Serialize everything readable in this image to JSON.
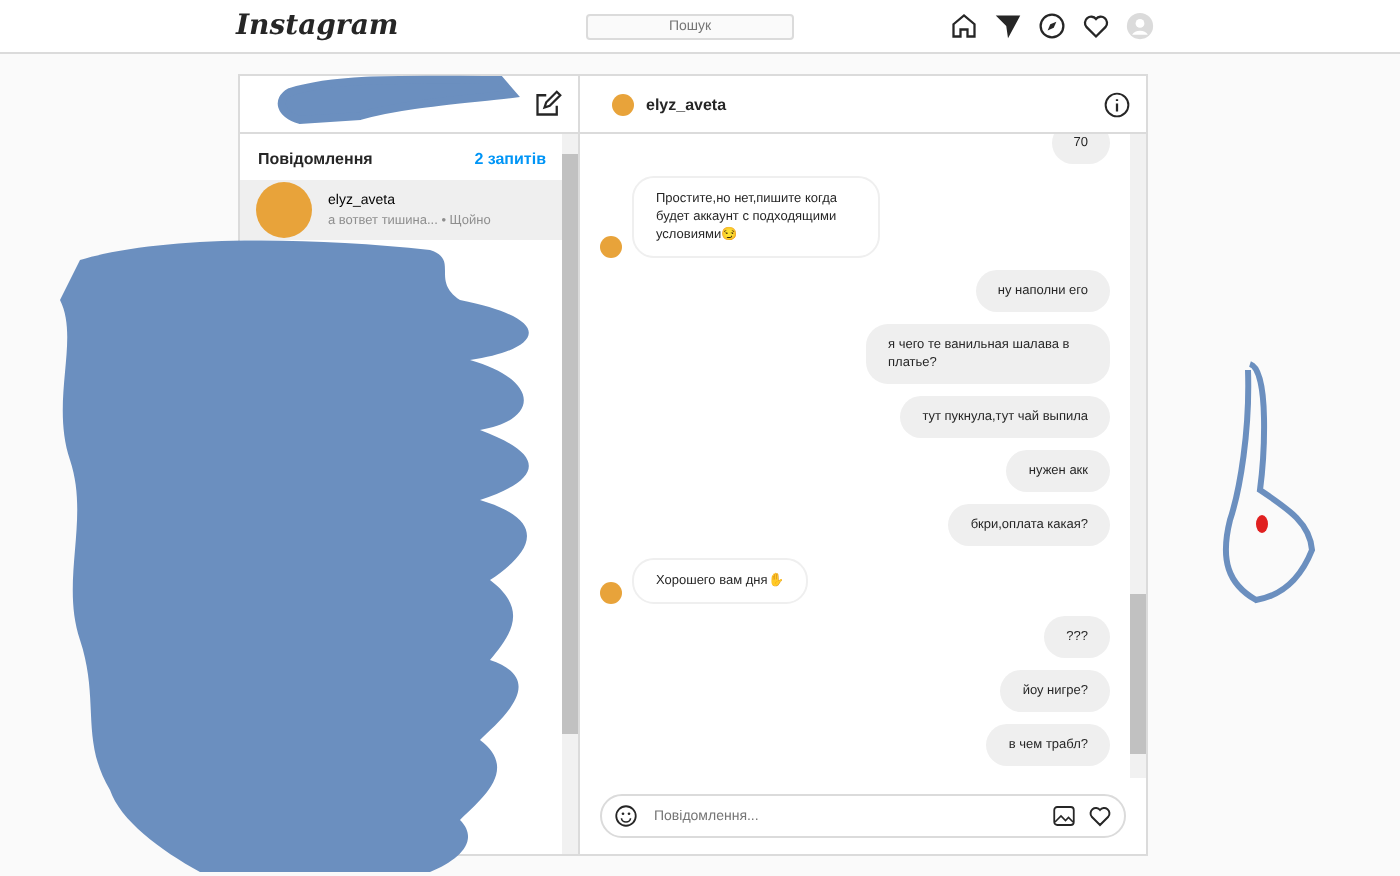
{
  "nav": {
    "logo": "Instagram",
    "search_placeholder": "Пошук"
  },
  "inbox": {
    "heading": "Повідомлення",
    "requests": "2 запитів",
    "threads": [
      {
        "name": "elyz_aveta",
        "preview": "а вответ тишина... • Щойно",
        "selected": true
      }
    ]
  },
  "chat": {
    "username": "elyz_aveta",
    "messages": [
      {
        "kind": "sent",
        "text": "70"
      },
      {
        "kind": "received",
        "text": "Простите,но нет,пишите когда будет аккаунт с подходящими условиями😏"
      },
      {
        "kind": "sent",
        "text": "ну наполни его"
      },
      {
        "kind": "sent",
        "text": "я чего те ванильная шалава в платье?"
      },
      {
        "kind": "sent",
        "text": "тут пукнула,тут чай выпила"
      },
      {
        "kind": "sent",
        "text": "нужен акк"
      },
      {
        "kind": "sent",
        "text": "бкри,оплата какая?"
      },
      {
        "kind": "received",
        "text": "Хорошего вам дня✋"
      },
      {
        "kind": "sent",
        "text": "???"
      },
      {
        "kind": "sent",
        "text": "йоу нигре?"
      },
      {
        "kind": "sent",
        "text": "в чем трабл?"
      }
    ],
    "composer": {
      "placeholder": "Повідомлення..."
    }
  }
}
